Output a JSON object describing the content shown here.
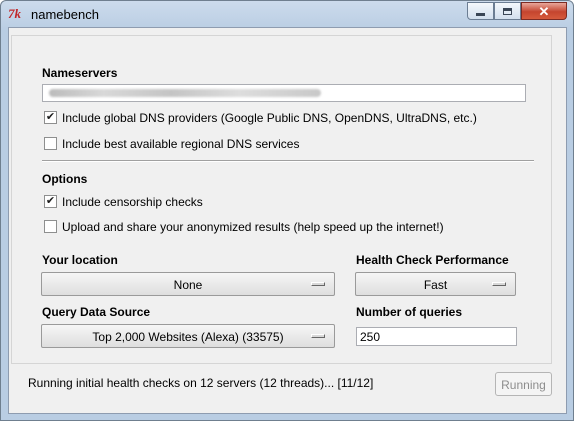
{
  "window": {
    "title": "namebench",
    "icon_text": "7k",
    "close_glyph": "✕"
  },
  "nameservers": {
    "heading": "Nameservers",
    "input_value": "",
    "include_global_label": "Include global DNS providers (Google Public DNS, OpenDNS, UltraDNS, etc.)",
    "include_global_checked": true,
    "include_regional_label": "Include best available regional DNS services",
    "include_regional_checked": false
  },
  "options": {
    "heading": "Options",
    "censorship_label": "Include censorship checks",
    "censorship_checked": true,
    "upload_label": "Upload and share your anonymized results (help speed up the internet!)",
    "upload_checked": false
  },
  "location": {
    "heading": "Your location",
    "selected": "None"
  },
  "health_check": {
    "heading": "Health Check Performance",
    "selected": "Fast"
  },
  "query_source": {
    "heading": "Query Data Source",
    "selected": "Top 2,000 Websites (Alexa) (33575)"
  },
  "num_queries": {
    "heading": "Number of queries",
    "value": "250"
  },
  "status": {
    "text": "Running initial health checks on 12 servers (12 threads)... [11/12]",
    "button_label": "Running"
  },
  "check_mark": "✔"
}
